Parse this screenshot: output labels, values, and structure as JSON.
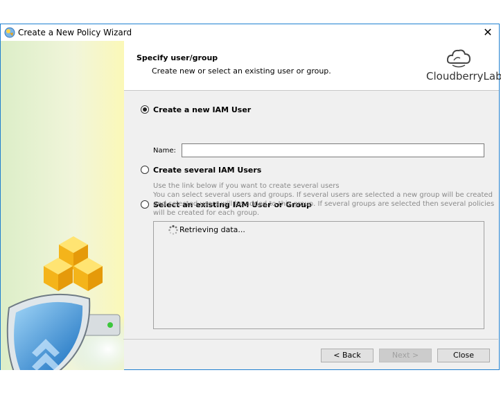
{
  "window": {
    "title": "Create a New Policy Wizard"
  },
  "header": {
    "title": "Specify user/group",
    "subtitle": "Create new or select an existing user or group.",
    "logo_text": "CloudberryLab"
  },
  "options": [
    {
      "label": "Create a new IAM User",
      "selected": true
    },
    {
      "label": "Create several IAM Users",
      "selected": false
    },
    {
      "label": "Select an existing IAM User or Group",
      "selected": false
    }
  ],
  "name_field": {
    "label": "Name:",
    "value": ""
  },
  "hints": {
    "several_users": "Use the link below if you want to create several users",
    "existing_line1": "You can select several users and groups. If several users are selected a new group will be created",
    "existing_line2": "and selected users will be added to this group. If several groups are selected then several policies",
    "existing_line3": "will be created for each group."
  },
  "list": {
    "loading_text": "Retrieving data..."
  },
  "buttons": {
    "back": "< Back",
    "next": "Next >",
    "close": "Close"
  },
  "colors": {
    "window_border": "#1e7fd0",
    "dialog_bg": "#f0f0f0"
  }
}
